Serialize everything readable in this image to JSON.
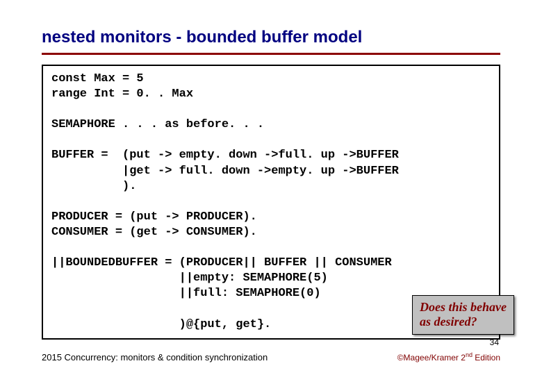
{
  "title": "nested monitors -  bounded buffer model",
  "code": "const Max = 5\nrange Int = 0. . Max\n\nSEMAPHORE . . . as before. . .\n\nBUFFER =  (put -> empty. down ->full. up ->BUFFER\n          |get -> full. down ->empty. up ->BUFFER\n          ).\n\nPRODUCER = (put -> PRODUCER).\nCONSUMER = (get -> CONSUMER).\n\n||BOUNDEDBUFFER = (PRODUCER|| BUFFER || CONSUMER\n                  ||empty: SEMAPHORE(5)\n                  ||full: SEMAPHORE(0)\n\n                  )@{put, get}.",
  "callout_line1": "Does this behave",
  "callout_line2": "as desired?",
  "page_number": "34",
  "footer_left": "2015  Concurrency: monitors & condition synchronization",
  "footer_copyright": "©Magee/Kramer ",
  "footer_edition_num": "2",
  "footer_edition_suffix": "nd",
  "footer_edition_word": " Edition"
}
